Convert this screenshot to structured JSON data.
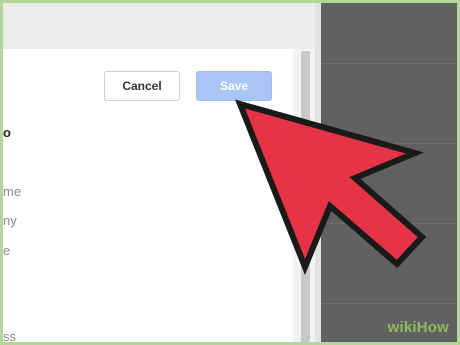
{
  "dialog": {
    "buttons": {
      "cancel_label": "Cancel",
      "save_label": "Save"
    },
    "fields": [
      {
        "label": "o",
        "emphasis": "bold"
      },
      {
        "label": "me",
        "emphasis": "normal"
      },
      {
        "label": "ny",
        "emphasis": "normal"
      },
      {
        "label": "e",
        "emphasis": "normal"
      },
      {
        "label": "ss",
        "emphasis": "normal"
      }
    ]
  },
  "cursor": {
    "icon": "arrow-pointer-icon",
    "color": "#e63345"
  },
  "watermark": {
    "brand": "wikiHow"
  },
  "colors": {
    "save_disabled": "#a9c5f5",
    "backdrop": "#5a5a5a",
    "frame": "#b5d69a"
  }
}
